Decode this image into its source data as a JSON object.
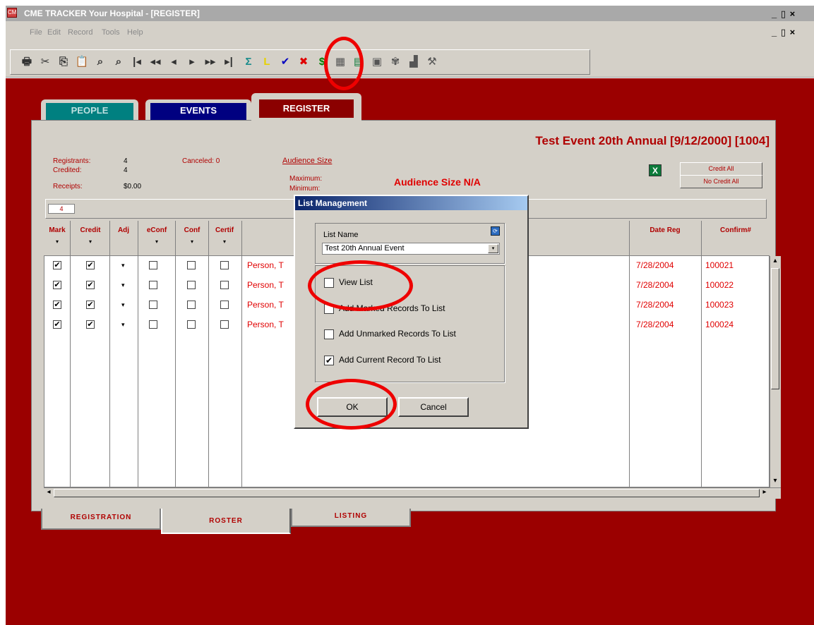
{
  "window": {
    "title": "CME TRACKER  Your Hospital - [REGISTER]",
    "app_icon_label": "CM",
    "controls": "_ ▯ ×",
    "controls_inner": "_ ▯ ×"
  },
  "menu": [
    "File",
    "Edit",
    "Record",
    "Tools",
    "Help"
  ],
  "toolbar": {
    "icons": [
      "print-icon",
      "cut-icon",
      "copy-icon",
      "paste-icon",
      "find-icon",
      "find-next-icon",
      "first-record-icon",
      "rewind-icon",
      "previous-icon",
      "next-icon",
      "fast-forward-icon",
      "last-record-icon",
      "sigma-icon",
      "list-management-icon",
      "check-icon",
      "delete-icon",
      "dollar-icon",
      "calculator-icon",
      "notes-icon",
      "card-icon",
      "tree-icon",
      "chart-icon",
      "tools-icon"
    ],
    "glyphs": [
      "🖶",
      "✂",
      "⎘",
      "📋",
      "⌕",
      "⌕",
      "|◂",
      "◂◂",
      "◂",
      "▸",
      "▸▸",
      "▸|",
      "Σ",
      "L",
      "✔",
      "✖",
      "$",
      "▦",
      "▤",
      "▣",
      "✾",
      "▟",
      "⚒"
    ],
    "colors": [
      "#333",
      "#333",
      "#333",
      "#333",
      "#333",
      "#333",
      "#333",
      "#333",
      "#333",
      "#333",
      "#333",
      "#333",
      "#1a8c8c",
      "#e6d200",
      "#0000c0",
      "#e00000",
      "#008000",
      "#555",
      "#0c7a3a",
      "#555",
      "#555",
      "#555",
      "#555"
    ]
  },
  "tabs_top": {
    "people": "PEOPLE",
    "events": "EVENTS",
    "register": "REGISTER"
  },
  "event_header": "Test Event 20th Annual [9/12/2000] [1004]",
  "stats": {
    "registrants_label": "Registrants:",
    "registrants_value": "4",
    "credited_label": "Credited:",
    "credited_value": "4",
    "receipts_label": "Receipts:",
    "receipts_value": "$0.00",
    "canceled": "Canceled: 0",
    "audience_link": "Audience Size",
    "maximum_label": "Maximum:",
    "minimum_label": "Minimum:",
    "audience_na": "Audience Size N/A"
  },
  "excel_icon_glyph": "X",
  "buttons": {
    "credit_all": "Credit All",
    "no_credit_all": "No Credit All"
  },
  "record_count": "4",
  "grid": {
    "columns": [
      "Mark",
      "Credit",
      "Adj",
      "eConf",
      "Conf",
      "Certif"
    ],
    "date_reg_header": "Date Reg",
    "confirm_header": "Confirm#",
    "sort_arrow": "▾",
    "check_glyph": "✔",
    "adj_glyph": "▾",
    "rows": [
      {
        "name": "Person, T",
        "date": "7/28/2004",
        "confirm": "100021"
      },
      {
        "name": "Person, T",
        "date": "7/28/2004",
        "confirm": "100022"
      },
      {
        "name": "Person, T",
        "date": "7/28/2004",
        "confirm": "100023"
      },
      {
        "name": "Person, T",
        "date": "7/28/2004",
        "confirm": "100024"
      }
    ]
  },
  "scroll": {
    "up": "▴",
    "down": "▾",
    "left": "◂",
    "right": "▸"
  },
  "tabs_bottom": {
    "registration": "REGISTRATION",
    "roster": "ROSTER",
    "listing": "LISTING"
  },
  "dialog": {
    "title": "List Management",
    "list_name_label": "List Name",
    "refresh_glyph": "⟳",
    "list_value": "Test 20th Annual Event",
    "dropdown_arrow": "▾",
    "check_glyph": "✔",
    "options": [
      {
        "label": "View List",
        "checked": false
      },
      {
        "label": "Add Marked Records To List",
        "checked": false
      },
      {
        "label": "Add Unmarked Records To List",
        "checked": false
      },
      {
        "label": "Add Current Record To List",
        "checked": true
      }
    ],
    "ok": "OK",
    "cancel": "Cancel"
  },
  "colors": {
    "workspace": "#9b0000",
    "annotation": "#ee0000",
    "text_red": "#b00000"
  }
}
